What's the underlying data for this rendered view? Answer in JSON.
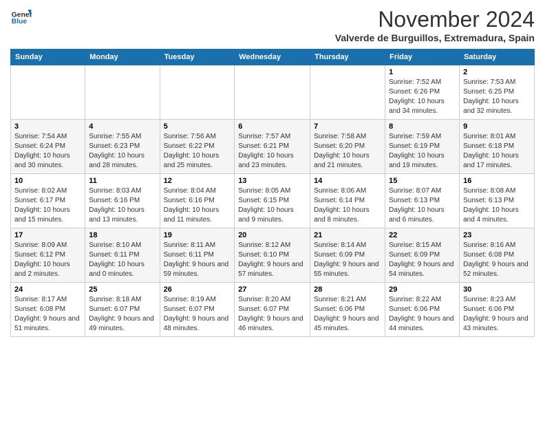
{
  "logo": {
    "line1": "General",
    "line2": "Blue"
  },
  "title": "November 2024",
  "location": "Valverde de Burguillos, Extremadura, Spain",
  "weekdays": [
    "Sunday",
    "Monday",
    "Tuesday",
    "Wednesday",
    "Thursday",
    "Friday",
    "Saturday"
  ],
  "weeks": [
    [
      {
        "day": "",
        "content": ""
      },
      {
        "day": "",
        "content": ""
      },
      {
        "day": "",
        "content": ""
      },
      {
        "day": "",
        "content": ""
      },
      {
        "day": "",
        "content": ""
      },
      {
        "day": "1",
        "content": "Sunrise: 7:52 AM\nSunset: 6:26 PM\nDaylight: 10 hours and 34 minutes."
      },
      {
        "day": "2",
        "content": "Sunrise: 7:53 AM\nSunset: 6:25 PM\nDaylight: 10 hours and 32 minutes."
      }
    ],
    [
      {
        "day": "3",
        "content": "Sunrise: 7:54 AM\nSunset: 6:24 PM\nDaylight: 10 hours and 30 minutes."
      },
      {
        "day": "4",
        "content": "Sunrise: 7:55 AM\nSunset: 6:23 PM\nDaylight: 10 hours and 28 minutes."
      },
      {
        "day": "5",
        "content": "Sunrise: 7:56 AM\nSunset: 6:22 PM\nDaylight: 10 hours and 25 minutes."
      },
      {
        "day": "6",
        "content": "Sunrise: 7:57 AM\nSunset: 6:21 PM\nDaylight: 10 hours and 23 minutes."
      },
      {
        "day": "7",
        "content": "Sunrise: 7:58 AM\nSunset: 6:20 PM\nDaylight: 10 hours and 21 minutes."
      },
      {
        "day": "8",
        "content": "Sunrise: 7:59 AM\nSunset: 6:19 PM\nDaylight: 10 hours and 19 minutes."
      },
      {
        "day": "9",
        "content": "Sunrise: 8:01 AM\nSunset: 6:18 PM\nDaylight: 10 hours and 17 minutes."
      }
    ],
    [
      {
        "day": "10",
        "content": "Sunrise: 8:02 AM\nSunset: 6:17 PM\nDaylight: 10 hours and 15 minutes."
      },
      {
        "day": "11",
        "content": "Sunrise: 8:03 AM\nSunset: 6:16 PM\nDaylight: 10 hours and 13 minutes."
      },
      {
        "day": "12",
        "content": "Sunrise: 8:04 AM\nSunset: 6:16 PM\nDaylight: 10 hours and 11 minutes."
      },
      {
        "day": "13",
        "content": "Sunrise: 8:05 AM\nSunset: 6:15 PM\nDaylight: 10 hours and 9 minutes."
      },
      {
        "day": "14",
        "content": "Sunrise: 8:06 AM\nSunset: 6:14 PM\nDaylight: 10 hours and 8 minutes."
      },
      {
        "day": "15",
        "content": "Sunrise: 8:07 AM\nSunset: 6:13 PM\nDaylight: 10 hours and 6 minutes."
      },
      {
        "day": "16",
        "content": "Sunrise: 8:08 AM\nSunset: 6:13 PM\nDaylight: 10 hours and 4 minutes."
      }
    ],
    [
      {
        "day": "17",
        "content": "Sunrise: 8:09 AM\nSunset: 6:12 PM\nDaylight: 10 hours and 2 minutes."
      },
      {
        "day": "18",
        "content": "Sunrise: 8:10 AM\nSunset: 6:11 PM\nDaylight: 10 hours and 0 minutes."
      },
      {
        "day": "19",
        "content": "Sunrise: 8:11 AM\nSunset: 6:11 PM\nDaylight: 9 hours and 59 minutes."
      },
      {
        "day": "20",
        "content": "Sunrise: 8:12 AM\nSunset: 6:10 PM\nDaylight: 9 hours and 57 minutes."
      },
      {
        "day": "21",
        "content": "Sunrise: 8:14 AM\nSunset: 6:09 PM\nDaylight: 9 hours and 55 minutes."
      },
      {
        "day": "22",
        "content": "Sunrise: 8:15 AM\nSunset: 6:09 PM\nDaylight: 9 hours and 54 minutes."
      },
      {
        "day": "23",
        "content": "Sunrise: 8:16 AM\nSunset: 6:08 PM\nDaylight: 9 hours and 52 minutes."
      }
    ],
    [
      {
        "day": "24",
        "content": "Sunrise: 8:17 AM\nSunset: 6:08 PM\nDaylight: 9 hours and 51 minutes."
      },
      {
        "day": "25",
        "content": "Sunrise: 8:18 AM\nSunset: 6:07 PM\nDaylight: 9 hours and 49 minutes."
      },
      {
        "day": "26",
        "content": "Sunrise: 8:19 AM\nSunset: 6:07 PM\nDaylight: 9 hours and 48 minutes."
      },
      {
        "day": "27",
        "content": "Sunrise: 8:20 AM\nSunset: 6:07 PM\nDaylight: 9 hours and 46 minutes."
      },
      {
        "day": "28",
        "content": "Sunrise: 8:21 AM\nSunset: 6:06 PM\nDaylight: 9 hours and 45 minutes."
      },
      {
        "day": "29",
        "content": "Sunrise: 8:22 AM\nSunset: 6:06 PM\nDaylight: 9 hours and 44 minutes."
      },
      {
        "day": "30",
        "content": "Sunrise: 8:23 AM\nSunset: 6:06 PM\nDaylight: 9 hours and 43 minutes."
      }
    ]
  ]
}
